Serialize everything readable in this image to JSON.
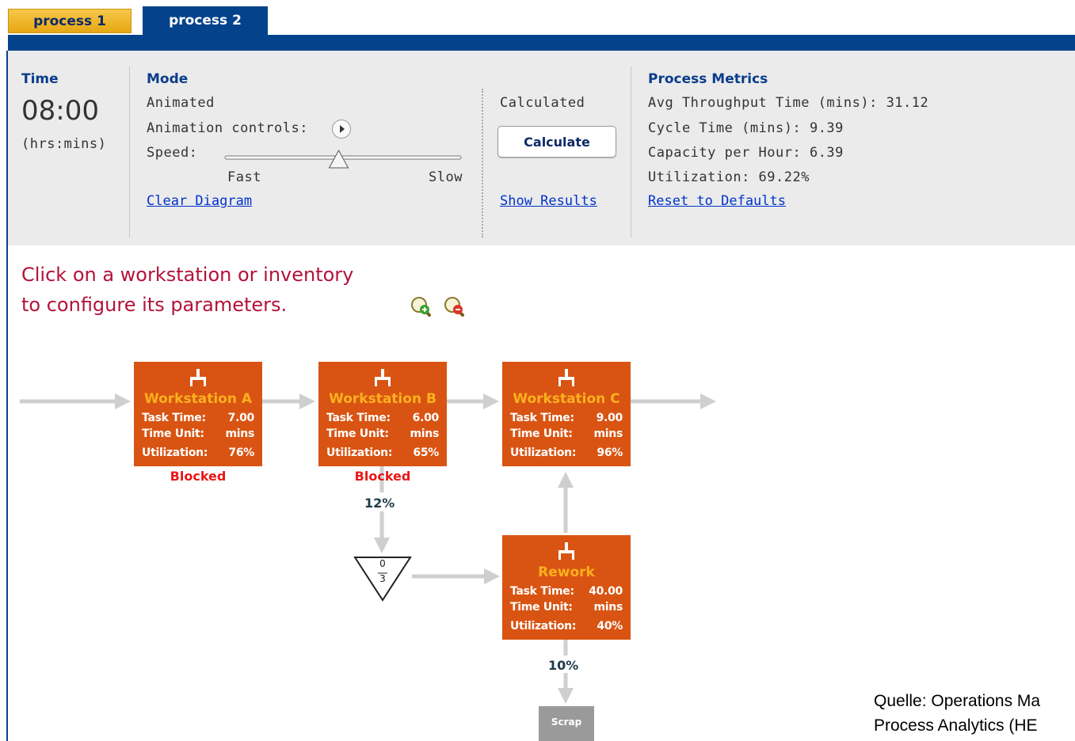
{
  "tabs": [
    {
      "label": "process 1",
      "active": false
    },
    {
      "label": "process 2",
      "active": true
    }
  ],
  "time": {
    "header": "Time",
    "value": "08:00",
    "unit": "(hrs:mins)"
  },
  "mode": {
    "header": "Mode",
    "animated_label": "Animated",
    "animation_controls_label": "Animation controls:",
    "speed_label": "Speed:",
    "speed_fast": "Fast",
    "speed_slow": "Slow",
    "speed_level": 0.48,
    "clear_link": "Clear Diagram",
    "calculated_label": "Calculated",
    "calculate_button": "Calculate",
    "show_results_link": "Show Results"
  },
  "metrics": {
    "header": "Process Metrics",
    "avg_throughput": "Avg Throughput Time (mins): 31.12",
    "cycle_time": "Cycle Time (mins): 9.39",
    "capacity": "Capacity per Hour: 6.39",
    "utilization": "Utilization: 69.22%",
    "reset_link": "Reset to Defaults"
  },
  "instructions": {
    "line1": "Click on a workstation or inventory",
    "line2": "to configure its parameters."
  },
  "workstations": [
    {
      "title": "Workstation A",
      "task_label": "Task Time:",
      "task_value": "7.00",
      "unit_label": "Time Unit:",
      "unit_value": "mins",
      "util_label": "Utilization:",
      "util_value": "76%",
      "status": "Blocked"
    },
    {
      "title": "Workstation B",
      "task_label": "Task Time:",
      "task_value": "6.00",
      "unit_label": "Time Unit:",
      "unit_value": "mins",
      "util_label": "Utilization:",
      "util_value": "65%",
      "status": "Blocked"
    },
    {
      "title": "Workstation C",
      "task_label": "Task Time:",
      "task_value": "9.00",
      "unit_label": "Time Unit:",
      "unit_value": "mins",
      "util_label": "Utilization:",
      "util_value": "96%",
      "status": ""
    },
    {
      "title": "Rework",
      "task_label": "Task Time:",
      "task_value": "40.00",
      "unit_label": "Time Unit:",
      "unit_value": "mins",
      "util_label": "Utilization:",
      "util_value": "40%",
      "status": ""
    }
  ],
  "inventory": {
    "top": "0",
    "bottom": "3"
  },
  "branches": {
    "rework_pct": "12%",
    "scrap_pct": "10%"
  },
  "scrap_label": "Scrap",
  "source": {
    "line1": "Quelle: Operations Ma",
    "line2": "Process Analytics (HE"
  },
  "colors": {
    "tab_active": "#04438c",
    "tab_inactive": "#f2b830",
    "workstation": "#d95412",
    "workstation_title": "#fbb11e",
    "blocked": "#e81818",
    "instruction": "#b3123a",
    "link": "#0033cc"
  }
}
